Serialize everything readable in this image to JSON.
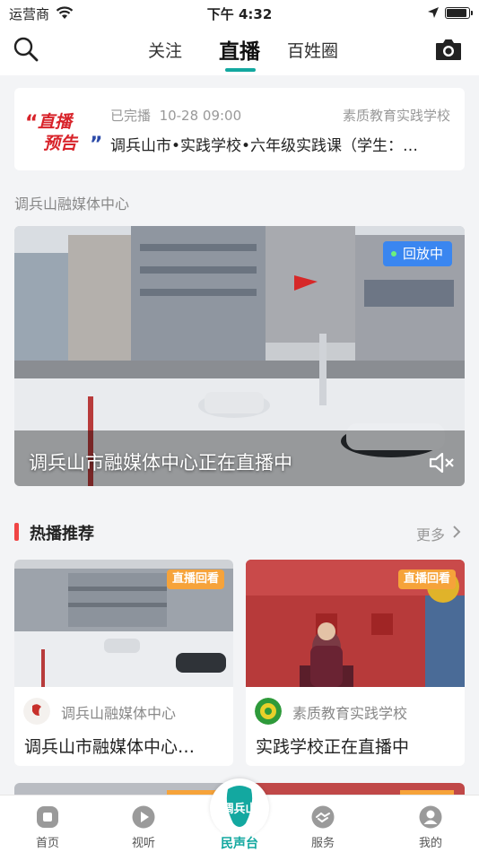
{
  "status_bar": {
    "carrier": "运营商",
    "time": "下午 4:32",
    "battery_level": 0.95
  },
  "nav": {
    "tabs": [
      "关注",
      "直播",
      "百姓圈"
    ],
    "active_tab": "直播"
  },
  "preview_card": {
    "status": "已完播",
    "datetime": "10-28 09:00",
    "school": "素质教育实践学校",
    "title": "调兵山市•实践学校•六年级实践课（学生：…",
    "badge_line1": "直播",
    "badge_line2": "预告"
  },
  "section_label": "调兵山融媒体中心",
  "live": {
    "badge": "回放中",
    "title": "调兵山市融媒体中心正在直播中"
  },
  "hot": {
    "title": "热播推荐",
    "more": "更多",
    "items": [
      {
        "tag": "直播回看",
        "source": "调兵山融媒体中心",
        "title": "调兵山市融媒体中心…"
      },
      {
        "tag": "直播回看",
        "source": "素质教育实践学校",
        "title": "实践学校正在直播中"
      }
    ]
  },
  "tabbar": {
    "items": [
      {
        "label": "首页",
        "icon": "home-icon"
      },
      {
        "label": "视听",
        "icon": "play-icon"
      },
      {
        "label": "民声台",
        "icon": "logo-icon"
      },
      {
        "label": "服务",
        "icon": "handshake-icon"
      },
      {
        "label": "我的",
        "icon": "user-icon"
      }
    ],
    "logo_text": "调兵山"
  },
  "colors": {
    "accent": "#13a8a0",
    "replay_badge": "#3a86f0",
    "hot_bar": "#f04545",
    "tag": "#f6a33a"
  }
}
